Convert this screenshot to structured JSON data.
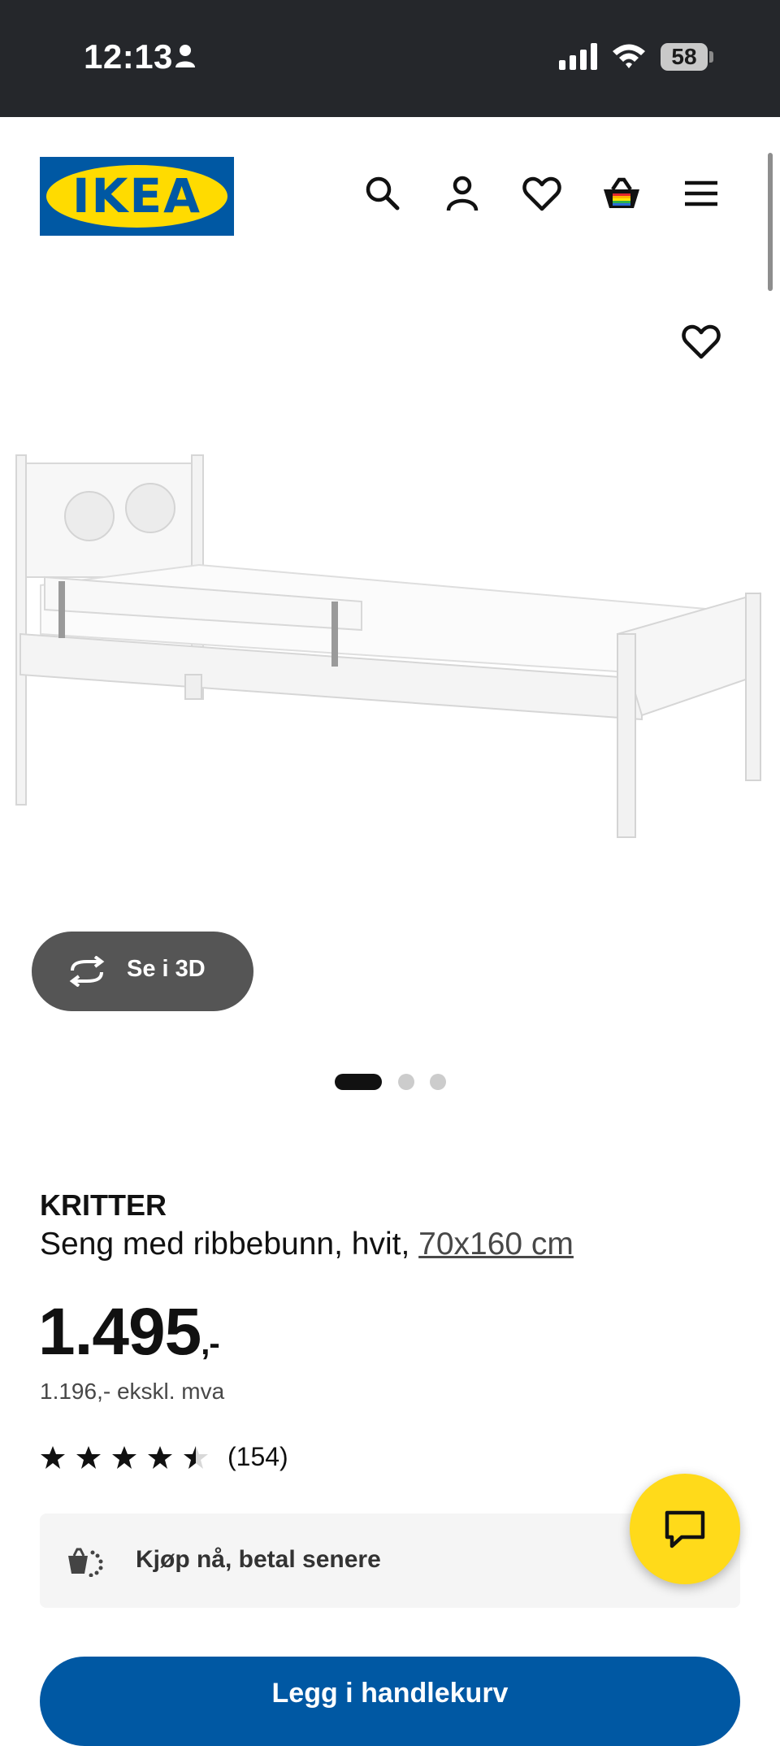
{
  "status_bar": {
    "time": "12:13",
    "battery": "58"
  },
  "header": {
    "logo_text": "IKEA",
    "icons": [
      "search-icon",
      "account-icon",
      "wishlist-icon",
      "cart-icon",
      "menu-icon"
    ]
  },
  "gallery": {
    "view_3d_label": "Se i 3D",
    "image_count": 3,
    "active_image": 1
  },
  "product": {
    "name": "KRITTER",
    "description": "Seng med ribbebunn, hvit, ",
    "size": "70x160 cm",
    "price": "1.495",
    "price_suffix": ",-",
    "price_ex_vat": "1.196,- ekskl. mva",
    "rating": 4.5,
    "review_count": "(154)"
  },
  "pay_later": {
    "label": "Kjøp nå, betal senere"
  },
  "add_to_cart": {
    "label": "Legg i handlekurv"
  },
  "colors": {
    "ikea_blue": "#0058a3",
    "ikea_yellow": "#ffdb00",
    "status_bar_bg": "#25272b",
    "chat_button": "#ffda1a"
  }
}
